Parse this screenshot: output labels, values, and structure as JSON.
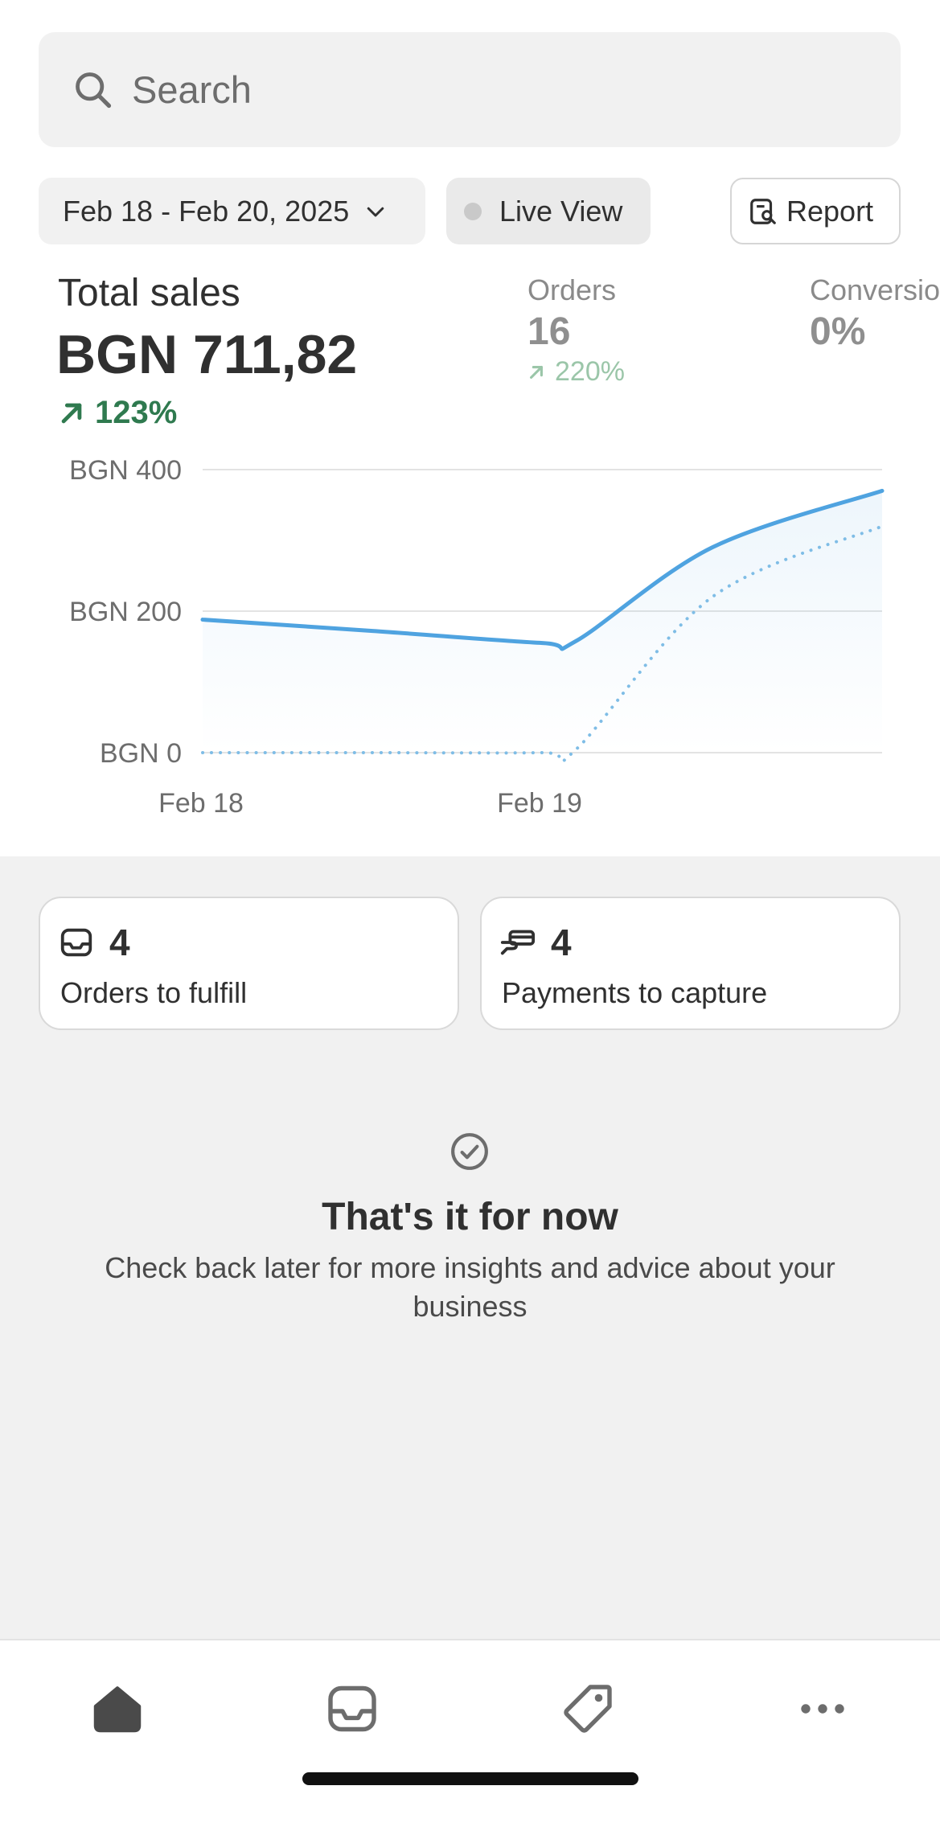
{
  "search": {
    "placeholder": "Search",
    "icon": "search-icon"
  },
  "filters": {
    "date_range": "Feb 18 - Feb 20, 2025",
    "live_view": "Live View",
    "report": "Report"
  },
  "metrics": {
    "total_sales": {
      "label": "Total sales",
      "value": "BGN 711,82",
      "delta": "123%"
    },
    "orders": {
      "label": "Orders",
      "value": "16",
      "delta": "220%"
    },
    "conversion": {
      "label": "Conversion",
      "value": "0%"
    }
  },
  "chart_data": {
    "type": "line",
    "x_tick_labels": [
      "Feb 18",
      "Feb 19"
    ],
    "y_tick_labels": [
      "BGN 400",
      "BGN 200",
      "BGN 0"
    ],
    "ylim": [
      0,
      400
    ],
    "grid": true,
    "series": [
      {
        "style": "solid",
        "color": "#4fa3e0",
        "x": [
          0,
          0.25,
          0.5,
          0.55,
          0.75,
          1
        ],
        "y": [
          188,
          172,
          155,
          158,
          290,
          370
        ]
      },
      {
        "style": "dotted",
        "color": "#7fbde6",
        "x": [
          0,
          0.25,
          0.5,
          0.55,
          0.75,
          1
        ],
        "y": [
          0,
          0,
          0,
          5,
          220,
          320
        ]
      }
    ]
  },
  "cards": [
    {
      "icon": "inbox-icon",
      "count": "4",
      "label": "Orders to fulfill"
    },
    {
      "icon": "payment-hand-icon",
      "count": "4",
      "label": "Payments to capture"
    }
  ],
  "empty_state": {
    "icon": "check-circle-icon",
    "title": "That's it for now",
    "text": "Check back later for more insights and advice about your business"
  },
  "tabbar": [
    "home-icon",
    "orders-inbox-icon",
    "products-tag-icon",
    "more-icon"
  ],
  "colors": {
    "accent_line": "#4fa3e0",
    "positive": "#2f7a4f"
  }
}
